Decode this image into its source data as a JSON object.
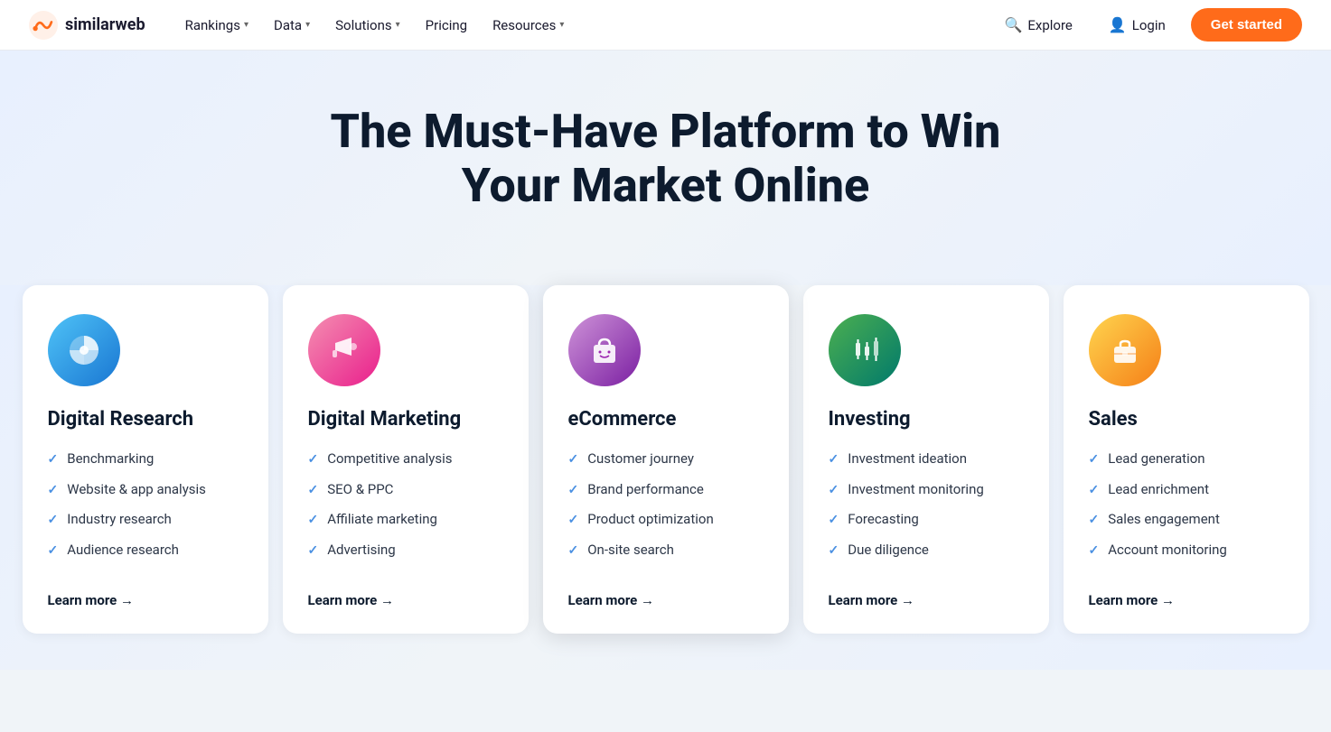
{
  "brand": {
    "name": "similarweb",
    "logo_icon": "SW"
  },
  "nav": {
    "links": [
      {
        "label": "Rankings",
        "has_dropdown": true
      },
      {
        "label": "Data",
        "has_dropdown": true
      },
      {
        "label": "Solutions",
        "has_dropdown": true
      },
      {
        "label": "Pricing",
        "has_dropdown": false
      },
      {
        "label": "Resources",
        "has_dropdown": true
      }
    ],
    "explore_label": "Explore",
    "login_label": "Login",
    "cta_label": "Get started"
  },
  "hero": {
    "title": "The Must-Have Platform to Win Your Market Online"
  },
  "cards": [
    {
      "id": "digital-research",
      "icon_label": "chart-pie-icon",
      "icon_emoji": "🔵",
      "icon_class": "card-icon-research",
      "title": "Digital Research",
      "items": [
        "Benchmarking",
        "Website & app analysis",
        "Industry research",
        "Audience research"
      ],
      "learn_more": "Learn more →",
      "highlighted": false
    },
    {
      "id": "digital-marketing",
      "icon_label": "megaphone-icon",
      "icon_emoji": "📣",
      "icon_class": "card-icon-marketing",
      "title": "Digital Marketing",
      "items": [
        "Competitive analysis",
        "SEO & PPC",
        "Affiliate marketing",
        "Advertising"
      ],
      "learn_more": "Learn more →",
      "highlighted": false
    },
    {
      "id": "ecommerce",
      "icon_label": "shopping-bag-icon",
      "icon_emoji": "🛍️",
      "icon_class": "card-icon-ecommerce",
      "title": "eCommerce",
      "items": [
        "Customer journey",
        "Brand performance",
        "Product optimization",
        "On-site search"
      ],
      "learn_more": "Learn more →",
      "highlighted": true
    },
    {
      "id": "investing",
      "icon_label": "candlestick-chart-icon",
      "icon_emoji": "📈",
      "icon_class": "card-icon-investing",
      "title": "Investing",
      "items": [
        "Investment ideation",
        "Investment monitoring",
        "Forecasting",
        "Due diligence"
      ],
      "learn_more": "Learn more →",
      "highlighted": false
    },
    {
      "id": "sales",
      "icon_label": "briefcase-icon",
      "icon_emoji": "💼",
      "icon_class": "card-icon-sales",
      "title": "Sales",
      "items": [
        "Lead generation",
        "Lead enrichment",
        "Sales engagement",
        "Account monitoring"
      ],
      "learn_more": "Learn more →",
      "highlighted": false
    }
  ]
}
